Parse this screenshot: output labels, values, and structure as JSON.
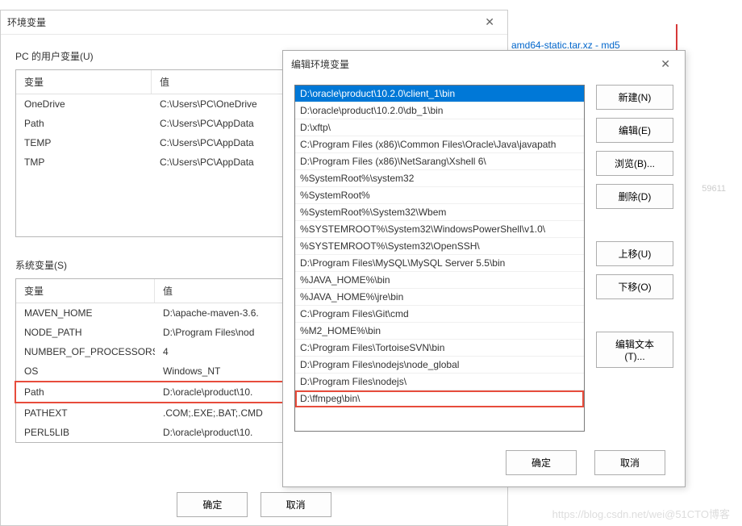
{
  "background": {
    "linkText": "amd64-static.tar.xz - md5",
    "grayId": "59611",
    "watermark": "https://blog.csdn.net/wei@51CTO博客"
  },
  "dialog1": {
    "title": "环境变量",
    "userSectionLabel": "PC 的用户变量(U)",
    "systemSectionLabel": "系统变量(S)",
    "varHeader": "变量",
    "valHeader": "值",
    "userVars": [
      {
        "name": "OneDrive",
        "value": "C:\\Users\\PC\\OneDrive"
      },
      {
        "name": "Path",
        "value": "C:\\Users\\PC\\AppData"
      },
      {
        "name": "TEMP",
        "value": "C:\\Users\\PC\\AppData"
      },
      {
        "name": "TMP",
        "value": "C:\\Users\\PC\\AppData"
      }
    ],
    "systemVars": [
      {
        "name": "MAVEN_HOME",
        "value": "D:\\apache-maven-3.6."
      },
      {
        "name": "NODE_PATH",
        "value": "D:\\Program Files\\nod"
      },
      {
        "name": "NUMBER_OF_PROCESSORS",
        "value": "4"
      },
      {
        "name": "OS",
        "value": "Windows_NT"
      },
      {
        "name": "Path",
        "value": "D:\\oracle\\product\\10."
      },
      {
        "name": "PATHEXT",
        "value": ".COM;.EXE;.BAT;.CMD"
      },
      {
        "name": "PERL5LIB",
        "value": "D:\\oracle\\product\\10."
      }
    ],
    "okButton": "确定",
    "cancelButton": "取消"
  },
  "dialog2": {
    "title": "编辑环境变量",
    "pathList": [
      "D:\\oracle\\product\\10.2.0\\client_1\\bin",
      "D:\\oracle\\product\\10.2.0\\db_1\\bin",
      "D:\\xftp\\",
      "C:\\Program Files (x86)\\Common Files\\Oracle\\Java\\javapath",
      "D:\\Program Files (x86)\\NetSarang\\Xshell 6\\",
      "%SystemRoot%\\system32",
      "%SystemRoot%",
      "%SystemRoot%\\System32\\Wbem",
      "%SYSTEMROOT%\\System32\\WindowsPowerShell\\v1.0\\",
      "%SYSTEMROOT%\\System32\\OpenSSH\\",
      "D:\\Program Files\\MySQL\\MySQL Server 5.5\\bin",
      "%JAVA_HOME%\\bin",
      "%JAVA_HOME%\\jre\\bin",
      "C:\\Program Files\\Git\\cmd",
      "%M2_HOME%\\bin",
      "C:\\Program Files\\TortoiseSVN\\bin",
      "D:\\Program Files\\nodejs\\node_global",
      "D:\\Program Files\\nodejs\\",
      "D:\\ffmpeg\\bin\\"
    ],
    "buttons": {
      "new": "新建(N)",
      "edit": "编辑(E)",
      "browse": "浏览(B)...",
      "delete": "删除(D)",
      "moveUp": "上移(U)",
      "moveDown": "下移(O)",
      "editText": "编辑文本(T)..."
    },
    "okButton": "确定",
    "cancelButton": "取消"
  }
}
